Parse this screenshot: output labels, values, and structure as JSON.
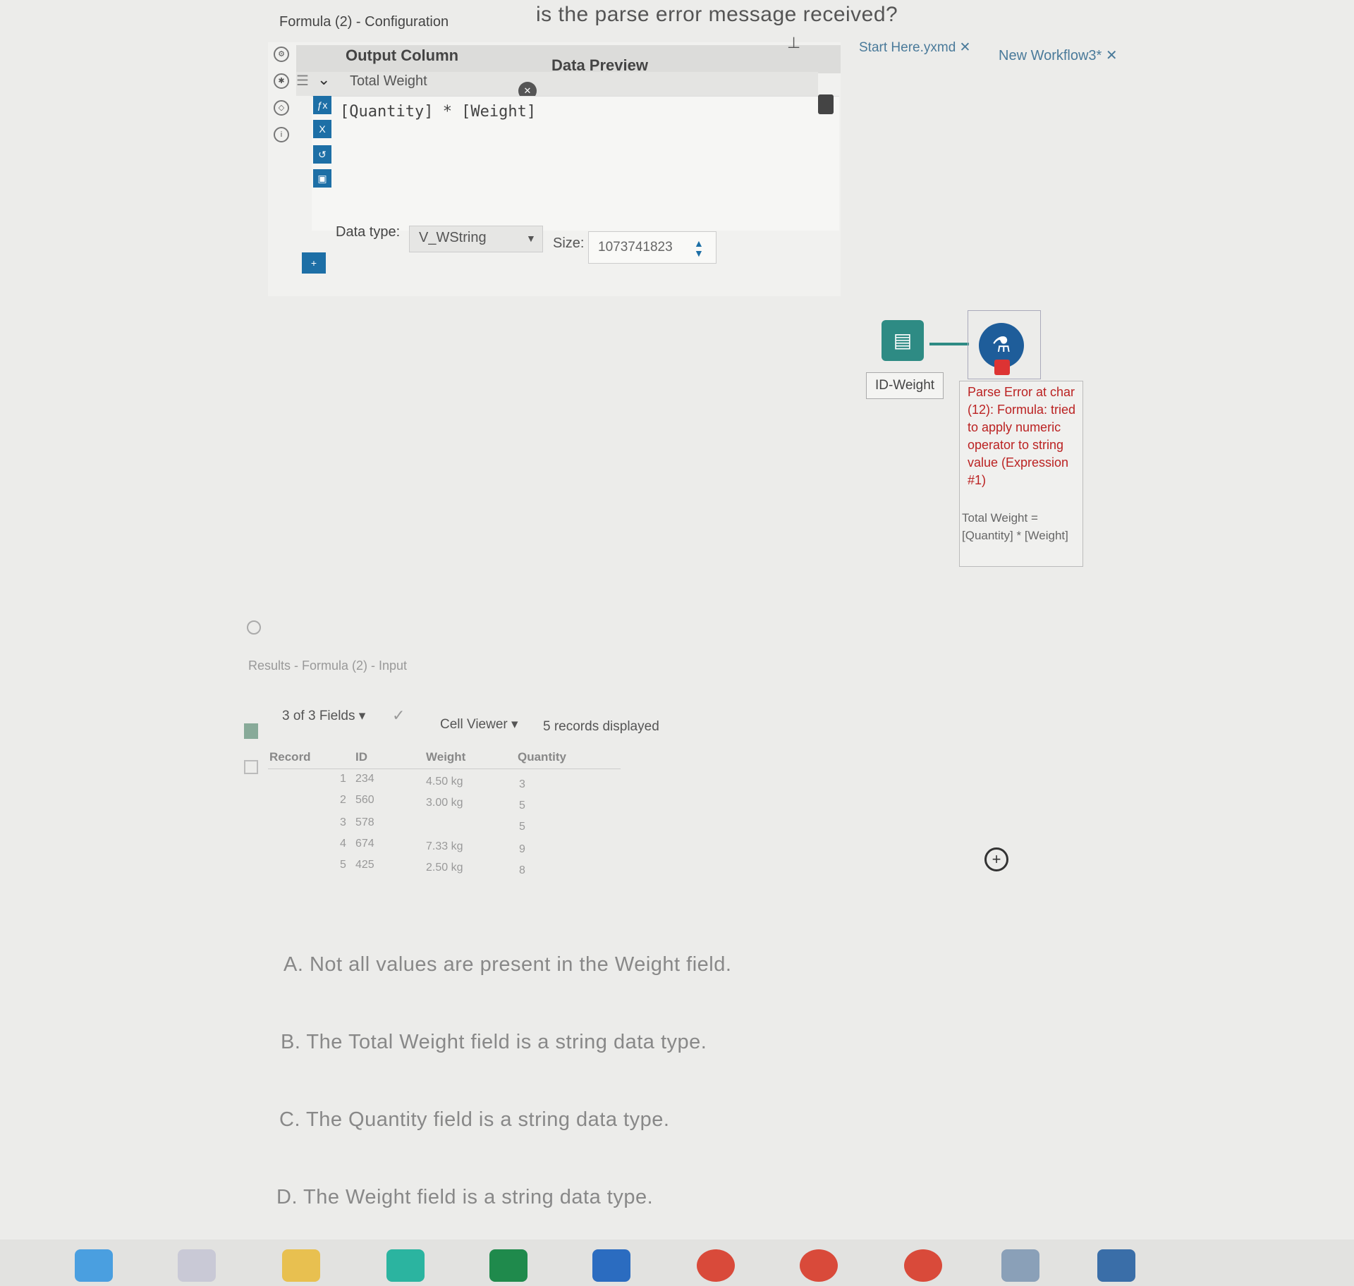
{
  "question": "is the parse error message received?",
  "config": {
    "title": "Formula (2) - Configuration",
    "header_output": "Output Column",
    "header_preview": "Data Preview",
    "output_column": "Total Weight",
    "expression": "[Quantity] * [Weight]",
    "data_type_label": "Data type:",
    "data_type_value": "V_WString",
    "size_label": "Size:",
    "size_value": "1073741823"
  },
  "tabs": [
    {
      "label": "Start Here.yxmd"
    },
    {
      "label": "New Workflow3*"
    }
  ],
  "workflow": {
    "input_label": "ID-Weight",
    "error_message": "Parse Error at char (12): Formula: tried to apply numeric operator to string value (Expression #1)",
    "formula_summary": "Total Weight = [Quantity] * [Weight]"
  },
  "results": {
    "title": "Results - Formula (2) - Input",
    "fields_label": "3 of 3 Fields",
    "viewer_label": "Cell Viewer",
    "records_label": "5 records displayed",
    "columns": [
      "Record",
      "ID",
      "Weight",
      "Quantity"
    ],
    "rows": [
      {
        "record": "1",
        "id": "234",
        "weight": "4.50 kg",
        "quantity": "3"
      },
      {
        "record": "2",
        "id": "560",
        "weight": "3.00 kg",
        "quantity": "5"
      },
      {
        "record": "3",
        "id": "578",
        "weight": "",
        "quantity": "5"
      },
      {
        "record": "4",
        "id": "674",
        "weight": "7.33 kg",
        "quantity": "9"
      },
      {
        "record": "5",
        "id": "425",
        "weight": "2.50 kg",
        "quantity": "8"
      }
    ]
  },
  "answers": [
    "A. Not all values are present in the Weight field.",
    "B. The Total Weight field is a string data type.",
    "C. The Quantity field is a string data type.",
    "D. The Weight field is a string data type."
  ],
  "colors": {
    "accent": "#1d6fa6",
    "error": "#b22222",
    "tool_teal": "#2e8b84"
  }
}
